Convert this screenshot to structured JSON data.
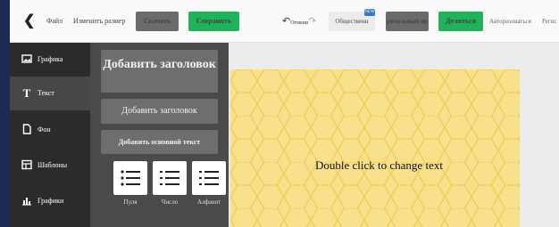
{
  "topbar": {
    "file": "Файл",
    "resize": "Изменить размер",
    "download": "Скачать",
    "save": "Сохранить",
    "undo_label": "Отмени",
    "public": "Общественн",
    "public_badge": "NEW",
    "print": "ритальный пр",
    "share": "Делиться",
    "login": "Авторизоваться",
    "register": "Регис"
  },
  "rail": {
    "items": [
      {
        "label": "Графика",
        "icon": "image-icon"
      },
      {
        "label": "Текст",
        "icon": "text-icon"
      },
      {
        "label": "Фон",
        "icon": "document-icon"
      },
      {
        "label": "Шаблоны",
        "icon": "template-icon"
      },
      {
        "label": "Графики",
        "icon": "chart-icon"
      }
    ]
  },
  "text_panel": {
    "add_heading_large": "Добавить заголовок",
    "add_heading": "Добавить заголовок",
    "add_body": "Добавить основной текст",
    "list_bullets": "Пуля",
    "list_numbers": "Число",
    "list_alpha": "Алфавит"
  },
  "canvas": {
    "placeholder": "Double click to change text",
    "background_color": "#f8e08d",
    "pattern_color": "#f0cf5e"
  },
  "colors": {
    "accent_green": "#1fb35a",
    "rail_bg": "#2b2b2b",
    "panel_bg": "#4a4a4a"
  }
}
